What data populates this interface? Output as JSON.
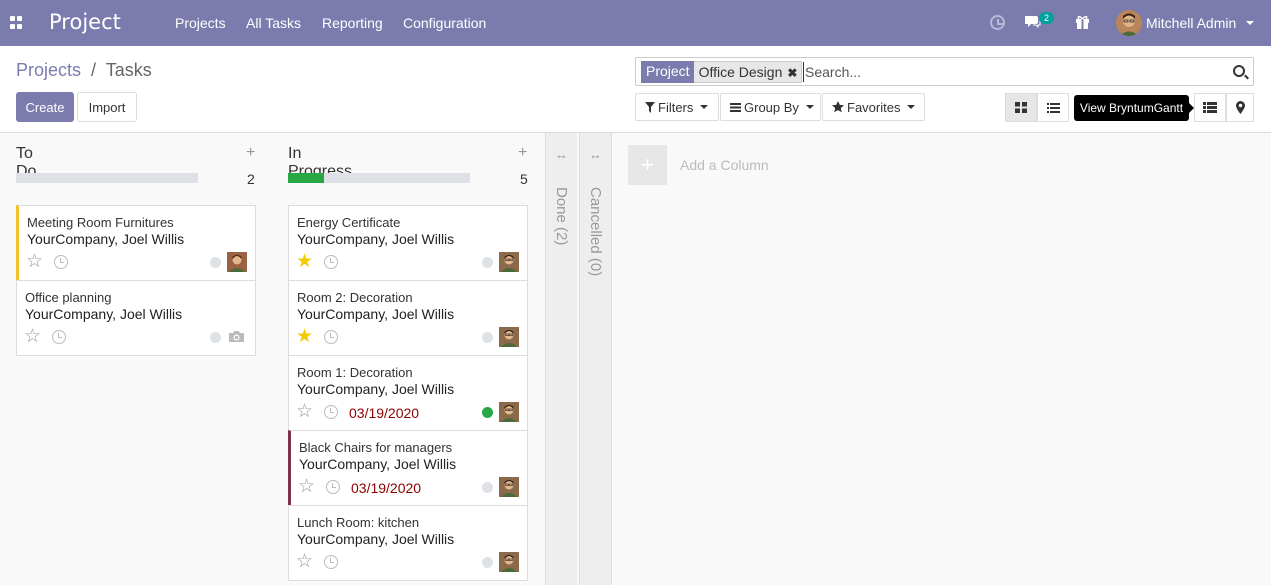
{
  "navbar": {
    "brand": "Project",
    "menu": [
      "Projects",
      "All Tasks",
      "Reporting",
      "Configuration"
    ],
    "message_count": "2",
    "user_name": "Mitchell Admin",
    "color": "#7c7bad"
  },
  "breadcrumb": {
    "parent": "Projects",
    "separator": "/",
    "current": "Tasks"
  },
  "buttons": {
    "create": "Create",
    "import": "Import"
  },
  "search": {
    "facet_label": "Project",
    "facet_value": "Office Design",
    "placeholder": "Search..."
  },
  "filters": {
    "filters_label": "Filters",
    "group_by_label": "Group By",
    "favorites_label": "Favorites"
  },
  "tooltip": "View BryntumGantt",
  "kanban": {
    "columns": [
      {
        "title": "To Do",
        "count": "2",
        "progress": 0,
        "cards": [
          {
            "title": "Meeting Room Furnitures",
            "sub": "YourCompany, Joel Willis",
            "starred": false,
            "date": "",
            "status": "normal",
            "avatar": "photo",
            "border": "warning"
          },
          {
            "title": "Office planning",
            "sub": "YourCompany, Joel Willis",
            "starred": false,
            "date": "",
            "status": "normal",
            "avatar": "placeholder",
            "border": "none"
          }
        ]
      },
      {
        "title": "In Progress",
        "count": "5",
        "progress": 0.2,
        "cards": [
          {
            "title": "Energy Certificate",
            "sub": "YourCompany, Joel Willis",
            "starred": true,
            "date": "",
            "status": "normal",
            "avatar": "photo",
            "border": "none"
          },
          {
            "title": "Room 2: Decoration",
            "sub": "YourCompany, Joel Willis",
            "starred": true,
            "date": "",
            "status": "normal",
            "avatar": "photo",
            "border": "none"
          },
          {
            "title": "Room 1: Decoration",
            "sub": "YourCompany, Joel Willis",
            "starred": false,
            "date": "03/19/2020",
            "status": "done",
            "avatar": "photo",
            "border": "none"
          },
          {
            "title": "Black Chairs for managers",
            "sub": "YourCompany, Joel Willis",
            "starred": false,
            "date": "03/19/2020",
            "status": "normal",
            "avatar": "photo",
            "border": "red"
          },
          {
            "title": "Lunch Room: kitchen",
            "sub": "YourCompany, Joel Willis",
            "starred": false,
            "date": "",
            "status": "normal",
            "avatar": "photo",
            "border": "none"
          }
        ]
      }
    ],
    "folded": [
      {
        "label": "Done (2)"
      },
      {
        "label": "Cancelled (0)"
      }
    ],
    "add_column_label": "Add a Column"
  }
}
